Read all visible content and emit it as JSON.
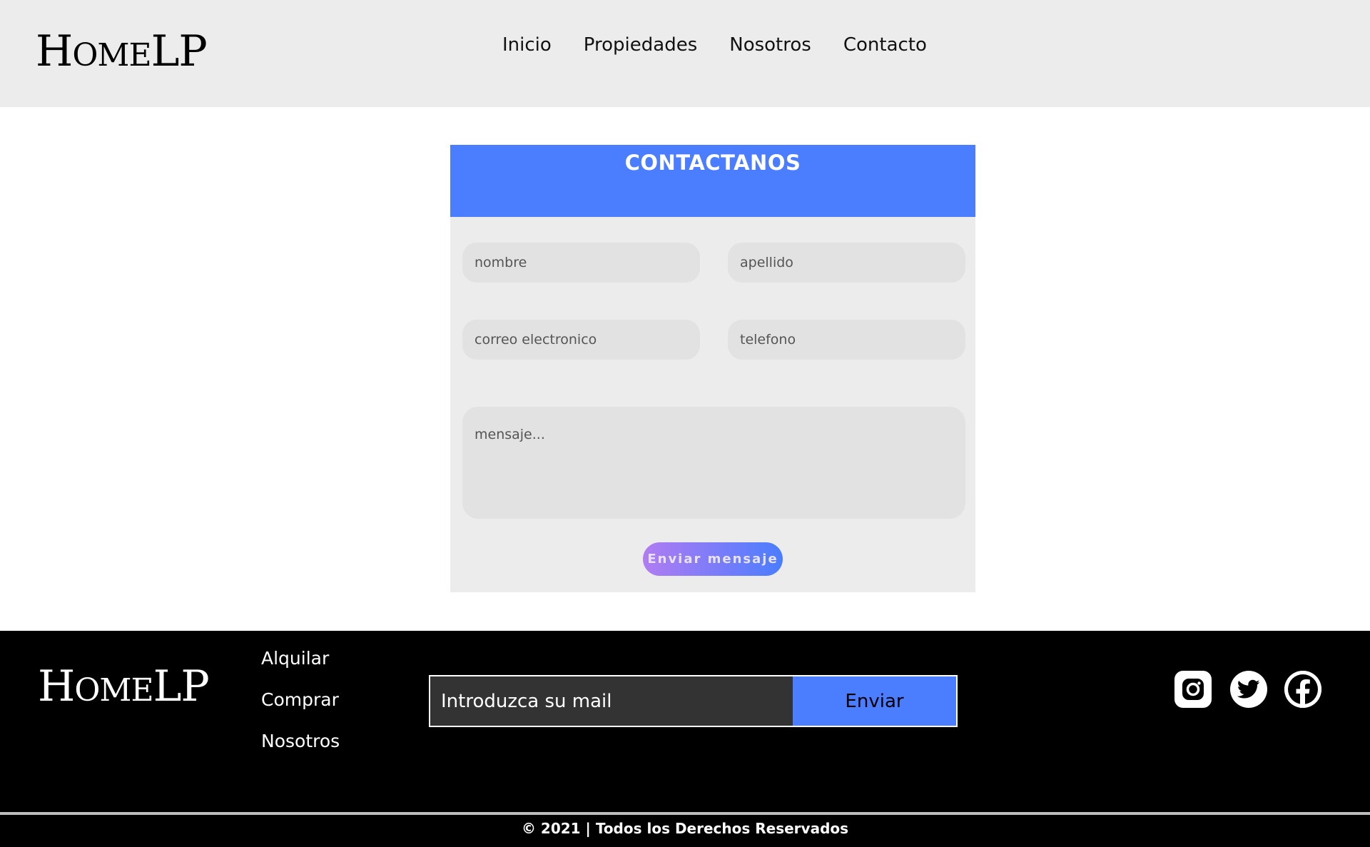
{
  "brand": {
    "logo_first": "H",
    "logo_rest": "OME",
    "logo_end": "LP"
  },
  "nav": {
    "items": [
      "Inicio",
      "Propiedades",
      "Nosotros",
      "Contacto"
    ]
  },
  "contact": {
    "title": "CONTACTANOS",
    "placeholders": {
      "nombre": "nombre",
      "apellido": "apellido",
      "correo": "correo electronico",
      "telefono": "telefono",
      "mensaje": "mensaje..."
    },
    "submit_label": "Enviar mensaje"
  },
  "footer": {
    "links": [
      "Alquilar",
      "Comprar",
      "Nosotros"
    ],
    "subscribe_placeholder": "Introduzca su mail",
    "subscribe_button": "Enviar",
    "social_icons": [
      "instagram-icon",
      "twitter-icon",
      "facebook-icon"
    ],
    "copyright": "© 2021 | Todos los Derechos Reservados"
  },
  "colors": {
    "accent_blue": "#4a7dff",
    "header_bg": "#ececec",
    "footer_bg": "#000000",
    "button_gradient_start": "#b17cf2"
  }
}
